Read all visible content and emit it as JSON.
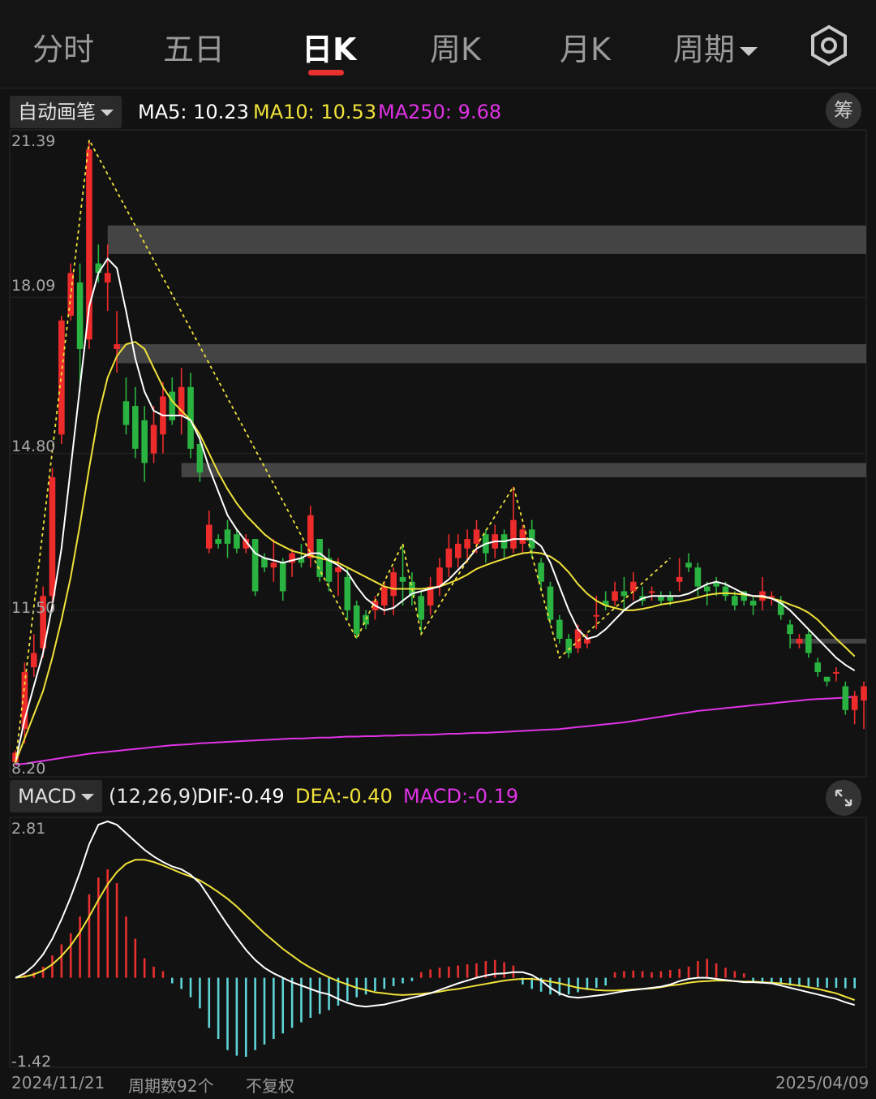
{
  "tabs": [
    {
      "label": "分时",
      "active": false
    },
    {
      "label": "五日",
      "active": false
    },
    {
      "label": "日K",
      "active": true
    },
    {
      "label": "周K",
      "active": false
    },
    {
      "label": "月K",
      "active": false
    },
    {
      "label": "周期",
      "active": false,
      "dropdown": true
    }
  ],
  "toolbar": {
    "settings_icon": "hexagon-gear-icon"
  },
  "main_panel": {
    "mode_label": "自动画笔",
    "ma5": {
      "label": "MA5:",
      "value": "10.23",
      "color": "#ffffff"
    },
    "ma10": {
      "label": "MA10:",
      "value": "10.53",
      "color": "#f0e23a"
    },
    "ma250": {
      "label": "MA250:",
      "value": "9.68",
      "color": "#e033e6"
    },
    "chip_button": "筹",
    "y_ticks": [
      "21.39",
      "18.09",
      "14.80",
      "11.50",
      "8.20"
    ]
  },
  "macd_panel": {
    "indicator_label": "MACD",
    "params": "(12,26,9)",
    "dif": {
      "label": "DIF:",
      "value": "-0.49",
      "color": "#ffffff"
    },
    "dea": {
      "label": "DEA:",
      "value": "-0.40",
      "color": "#f0e23a"
    },
    "macd": {
      "label": "MACD:",
      "value": "-0.19",
      "color": "#e033e6"
    },
    "expand_icon": "expand-arrows-icon",
    "y_ticks": [
      "2.81",
      "-1.42"
    ]
  },
  "footer": {
    "start_date": "2024/11/21",
    "period_count": "周期数92个",
    "adjust_mode": "不复权",
    "end_date": "2025/04/09"
  },
  "colors": {
    "up": "#ee2b2b",
    "down": "#2ab340",
    "ma250": "#e033e6",
    "hist_up": "#e8302f",
    "hist_down": "#5fd4d8"
  },
  "chart_data": [
    {
      "type": "candlestick",
      "y_axis_ticks": [
        21.39,
        18.09,
        14.8,
        11.5,
        8.2
      ],
      "ylim": [
        8.2,
        21.39
      ],
      "periods": 92,
      "candles": [
        [
          8.3,
          8.5,
          8.25,
          8.55
        ],
        [
          9.0,
          10.2,
          8.7,
          10.4
        ],
        [
          10.3,
          10.6,
          10.1,
          11.0
        ],
        [
          10.7,
          11.8,
          10.5,
          12.0
        ],
        [
          11.8,
          14.3,
          11.5,
          14.5
        ],
        [
          15.2,
          17.6,
          15.0,
          17.7
        ],
        [
          17.7,
          18.6,
          17.6,
          18.8
        ],
        [
          18.4,
          17.0,
          16.1,
          18.8
        ],
        [
          17.2,
          21.2,
          17.0,
          21.4
        ],
        [
          18.8,
          18.6,
          18.4,
          19.2
        ],
        [
          18.4,
          18.6,
          17.8,
          19.2
        ],
        [
          17.0,
          17.1,
          16.5,
          17.8
        ],
        [
          15.9,
          15.4,
          15.2,
          16.4
        ],
        [
          15.8,
          14.9,
          14.7,
          16.2
        ],
        [
          15.5,
          14.6,
          14.2,
          15.8
        ],
        [
          14.8,
          15.4,
          14.6,
          15.8
        ],
        [
          15.2,
          16.0,
          14.8,
          16.3
        ],
        [
          16.1,
          15.5,
          15.4,
          16.4
        ],
        [
          15.6,
          16.2,
          15.2,
          16.6
        ],
        [
          16.2,
          14.9,
          14.7,
          16.5
        ],
        [
          15.0,
          14.4,
          14.2,
          15.2
        ],
        [
          12.8,
          13.3,
          12.7,
          13.6
        ],
        [
          13.0,
          12.9,
          12.8,
          13.1
        ],
        [
          13.2,
          12.9,
          12.6,
          13.4
        ],
        [
          13.1,
          12.8,
          12.7,
          13.2
        ],
        [
          12.8,
          13.0,
          12.7,
          13.1
        ],
        [
          13.0,
          11.9,
          11.8,
          13.0
        ],
        [
          12.6,
          12.4,
          12.3,
          12.7
        ],
        [
          12.4,
          12.5,
          12.1,
          13.0
        ],
        [
          12.5,
          11.9,
          11.7,
          12.6
        ],
        [
          12.5,
          12.7,
          12.2,
          12.8
        ],
        [
          12.6,
          12.5,
          12.4,
          12.9
        ],
        [
          12.6,
          13.5,
          12.4,
          13.7
        ],
        [
          13.0,
          12.2,
          12.1,
          13.0
        ],
        [
          12.6,
          12.1,
          11.9,
          12.8
        ],
        [
          12.3,
          12.4,
          11.8,
          12.6
        ],
        [
          12.2,
          11.5,
          11.3,
          12.4
        ],
        [
          11.6,
          11.0,
          10.9,
          11.7
        ],
        [
          11.4,
          11.2,
          11.1,
          11.5
        ],
        [
          11.5,
          11.7,
          11.3,
          11.8
        ],
        [
          11.6,
          12.0,
          11.4,
          12.1
        ],
        [
          11.8,
          12.3,
          11.4,
          12.4
        ],
        [
          12.2,
          12.1,
          11.6,
          12.9
        ],
        [
          12.1,
          11.8,
          11.6,
          12.3
        ],
        [
          11.8,
          11.3,
          11.0,
          11.9
        ],
        [
          11.6,
          12.0,
          11.4,
          12.2
        ],
        [
          12.0,
          12.4,
          11.8,
          12.6
        ],
        [
          12.4,
          12.8,
          12.2,
          13.1
        ],
        [
          12.6,
          12.9,
          12.4,
          13.1
        ],
        [
          12.8,
          13.0,
          12.5,
          13.2
        ],
        [
          12.9,
          13.2,
          12.7,
          13.4
        ],
        [
          13.1,
          12.7,
          12.5,
          13.2
        ],
        [
          12.8,
          13.1,
          12.6,
          13.3
        ],
        [
          13.1,
          12.8,
          12.6,
          13.2
        ],
        [
          12.8,
          13.4,
          12.7,
          14.1
        ],
        [
          12.9,
          13.2,
          12.7,
          13.3
        ],
        [
          13.2,
          12.8,
          12.6,
          13.4
        ],
        [
          12.5,
          12.1,
          11.9,
          12.6
        ],
        [
          12.0,
          11.3,
          11.2,
          12.1
        ],
        [
          11.3,
          10.9,
          10.8,
          11.4
        ],
        [
          10.9,
          10.6,
          10.5,
          11.0
        ],
        [
          10.7,
          11.1,
          10.6,
          11.2
        ],
        [
          10.8,
          10.9,
          10.7,
          11.0
        ],
        [
          11.4,
          11.4,
          11.1,
          11.8
        ],
        [
          11.7,
          11.6,
          11.5,
          11.9
        ],
        [
          11.7,
          11.9,
          11.6,
          12.1
        ],
        [
          11.9,
          11.8,
          11.5,
          12.2
        ],
        [
          11.9,
          12.1,
          11.7,
          12.3
        ],
        [
          11.8,
          11.7,
          11.6,
          12.0
        ],
        [
          11.9,
          11.9,
          11.7,
          12.0
        ],
        [
          11.8,
          11.7,
          11.6,
          11.9
        ],
        [
          11.8,
          11.7,
          11.6,
          11.9
        ],
        [
          12.1,
          12.2,
          11.9,
          12.6
        ],
        [
          12.5,
          12.4,
          12.3,
          12.7
        ],
        [
          12.4,
          12.0,
          11.8,
          12.5
        ],
        [
          12.0,
          11.9,
          11.6,
          12.1
        ],
        [
          12.1,
          12.0,
          11.8,
          12.2
        ],
        [
          12.0,
          11.8,
          11.7,
          12.1
        ],
        [
          11.8,
          11.6,
          11.5,
          11.9
        ],
        [
          11.9,
          11.7,
          11.6,
          11.9
        ],
        [
          11.7,
          11.6,
          11.4,
          11.8
        ],
        [
          11.7,
          11.9,
          11.5,
          12.2
        ],
        [
          11.8,
          11.8,
          11.6,
          11.9
        ],
        [
          11.7,
          11.4,
          11.3,
          11.8
        ],
        [
          11.2,
          11.0,
          10.7,
          11.3
        ],
        [
          10.8,
          10.9,
          10.7,
          11.0
        ],
        [
          11.0,
          10.6,
          10.5,
          11.1
        ],
        [
          10.4,
          10.2,
          10.1,
          10.5
        ],
        [
          10.1,
          10.0,
          9.9,
          10.1
        ],
        [
          10.2,
          10.2,
          10.0,
          10.3
        ],
        [
          9.9,
          9.4,
          9.3,
          10.0
        ],
        [
          9.4,
          9.7,
          9.1,
          9.8
        ],
        [
          9.6,
          9.9,
          9.0,
          10.0
        ]
      ],
      "ma5": [
        8.3,
        9.2,
        9.9,
        10.6,
        11.6,
        12.8,
        14.5,
        16.2,
        17.9,
        18.6,
        18.9,
        18.7,
        17.8,
        16.8,
        16.1,
        15.7,
        15.6,
        15.6,
        15.6,
        15.5,
        15.1,
        14.5,
        14.0,
        13.5,
        13.2,
        12.95,
        12.7,
        12.6,
        12.55,
        12.5,
        12.55,
        12.6,
        12.7,
        12.7,
        12.55,
        12.45,
        12.3,
        12.0,
        11.75,
        11.6,
        11.5,
        11.55,
        11.7,
        11.85,
        11.9,
        11.95,
        12.0,
        12.15,
        12.35,
        12.55,
        12.8,
        12.9,
        12.95,
        12.95,
        13.0,
        13.0,
        13.0,
        12.85,
        12.5,
        12.0,
        11.5,
        11.1,
        10.9,
        10.95,
        11.1,
        11.3,
        11.5,
        11.65,
        11.75,
        11.8,
        11.8,
        11.8,
        11.8,
        11.85,
        11.95,
        12.05,
        12.1,
        12.05,
        11.95,
        11.85,
        11.8,
        11.8,
        11.75,
        11.65,
        11.5,
        11.3,
        11.1,
        10.9,
        10.7,
        10.5,
        10.35,
        10.23
      ],
      "ma10": [
        8.3,
        8.8,
        9.3,
        9.8,
        10.5,
        11.3,
        12.2,
        13.3,
        14.5,
        15.6,
        16.4,
        16.85,
        17.1,
        17.15,
        17.0,
        16.6,
        16.2,
        15.9,
        15.7,
        15.5,
        15.2,
        14.8,
        14.4,
        14.05,
        13.75,
        13.5,
        13.3,
        13.1,
        12.95,
        12.85,
        12.75,
        12.7,
        12.65,
        12.6,
        12.55,
        12.5,
        12.4,
        12.3,
        12.2,
        12.1,
        12.0,
        11.95,
        11.95,
        11.95,
        11.95,
        11.97,
        12.0,
        12.07,
        12.15,
        12.25,
        12.37,
        12.45,
        12.52,
        12.58,
        12.65,
        12.7,
        12.72,
        12.7,
        12.63,
        12.5,
        12.3,
        12.05,
        11.85,
        11.7,
        11.6,
        11.55,
        11.5,
        11.5,
        11.53,
        11.57,
        11.62,
        11.65,
        11.68,
        11.72,
        11.77,
        11.82,
        11.85,
        11.86,
        11.85,
        11.83,
        11.8,
        11.78,
        11.75,
        11.7,
        11.62,
        11.55,
        11.45,
        11.3,
        11.1,
        10.9,
        10.72,
        10.53
      ],
      "ma250": [
        8.25,
        8.27,
        8.3,
        8.33,
        8.36,
        8.39,
        8.42,
        8.45,
        8.48,
        8.5,
        8.52,
        8.54,
        8.56,
        8.58,
        8.6,
        8.62,
        8.64,
        8.66,
        8.67,
        8.68,
        8.7,
        8.71,
        8.72,
        8.73,
        8.74,
        8.75,
        8.76,
        8.77,
        8.78,
        8.79,
        8.8,
        8.8,
        8.81,
        8.82,
        8.82,
        8.83,
        8.84,
        8.84,
        8.85,
        8.85,
        8.86,
        8.86,
        8.87,
        8.87,
        8.88,
        8.88,
        8.89,
        8.9,
        8.9,
        8.91,
        8.92,
        8.92,
        8.93,
        8.94,
        8.95,
        8.96,
        8.97,
        8.98,
        8.99,
        9.0,
        9.02,
        9.04,
        9.06,
        9.08,
        9.1,
        9.12,
        9.14,
        9.17,
        9.2,
        9.23,
        9.26,
        9.29,
        9.32,
        9.35,
        9.38,
        9.4,
        9.42,
        9.44,
        9.46,
        9.48,
        9.5,
        9.52,
        9.54,
        9.56,
        9.58,
        9.6,
        9.62,
        9.63,
        9.64,
        9.65,
        9.66,
        9.68
      ],
      "bi_pivots": [
        [
          0,
          8.3
        ],
        [
          8,
          21.4
        ],
        [
          37,
          10.9
        ],
        [
          42,
          12.9
        ],
        [
          44,
          11.0
        ],
        [
          54,
          14.1
        ],
        [
          59,
          10.5
        ],
        [
          71,
          12.6
        ]
      ],
      "resistance_bands": [
        [
          10,
          19.0,
          19.6
        ],
        [
          11,
          16.7,
          17.1
        ],
        [
          18,
          14.3,
          14.6
        ],
        [
          84,
          10.8,
          10.9
        ]
      ]
    },
    {
      "type": "macd",
      "params": [
        12,
        26,
        9
      ],
      "y_axis_ticks": [
        2.81,
        -1.42
      ],
      "ylim": [
        -1.42,
        2.81
      ],
      "dif": [
        0.0,
        0.08,
        0.22,
        0.42,
        0.7,
        1.05,
        1.45,
        1.9,
        2.4,
        2.75,
        2.81,
        2.75,
        2.6,
        2.45,
        2.3,
        2.18,
        2.08,
        2.0,
        1.95,
        1.85,
        1.7,
        1.45,
        1.2,
        0.95,
        0.72,
        0.5,
        0.32,
        0.18,
        0.08,
        0.0,
        -0.08,
        -0.14,
        -0.2,
        -0.26,
        -0.3,
        -0.38,
        -0.45,
        -0.5,
        -0.52,
        -0.5,
        -0.48,
        -0.44,
        -0.4,
        -0.36,
        -0.32,
        -0.28,
        -0.22,
        -0.16,
        -0.1,
        -0.05,
        0.0,
        0.04,
        0.07,
        0.08,
        0.1,
        0.1,
        0.05,
        -0.05,
        -0.18,
        -0.28,
        -0.34,
        -0.36,
        -0.34,
        -0.32,
        -0.3,
        -0.27,
        -0.24,
        -0.22,
        -0.2,
        -0.18,
        -0.16,
        -0.12,
        -0.06,
        -0.02,
        0.0,
        0.0,
        -0.02,
        -0.04,
        -0.06,
        -0.08,
        -0.08,
        -0.09,
        -0.1,
        -0.14,
        -0.18,
        -0.22,
        -0.26,
        -0.3,
        -0.34,
        -0.38,
        -0.44,
        -0.49
      ],
      "dea": [
        0.0,
        0.02,
        0.06,
        0.13,
        0.24,
        0.39,
        0.58,
        0.82,
        1.1,
        1.4,
        1.68,
        1.9,
        2.05,
        2.12,
        2.12,
        2.08,
        2.02,
        1.95,
        1.88,
        1.82,
        1.75,
        1.65,
        1.54,
        1.42,
        1.28,
        1.12,
        0.96,
        0.8,
        0.66,
        0.52,
        0.4,
        0.28,
        0.18,
        0.09,
        0.01,
        -0.06,
        -0.12,
        -0.18,
        -0.22,
        -0.26,
        -0.28,
        -0.3,
        -0.31,
        -0.3,
        -0.29,
        -0.27,
        -0.25,
        -0.22,
        -0.2,
        -0.17,
        -0.14,
        -0.11,
        -0.08,
        -0.05,
        -0.03,
        -0.02,
        -0.02,
        -0.04,
        -0.07,
        -0.1,
        -0.14,
        -0.18,
        -0.2,
        -0.22,
        -0.23,
        -0.23,
        -0.22,
        -0.21,
        -0.2,
        -0.19,
        -0.17,
        -0.14,
        -0.12,
        -0.09,
        -0.07,
        -0.06,
        -0.05,
        -0.05,
        -0.06,
        -0.07,
        -0.07,
        -0.08,
        -0.09,
        -0.1,
        -0.12,
        -0.14,
        -0.17,
        -0.2,
        -0.24,
        -0.28,
        -0.34,
        -0.4
      ],
      "hist": [
        0.0,
        0.05,
        0.1,
        0.2,
        0.4,
        0.6,
        0.8,
        1.1,
        1.5,
        1.8,
        1.95,
        1.7,
        1.1,
        0.7,
        0.35,
        0.2,
        0.12,
        -0.1,
        -0.2,
        -0.35,
        -0.55,
        -0.9,
        -1.1,
        -1.3,
        -1.4,
        -1.42,
        -1.3,
        -1.2,
        -1.1,
        -1.0,
        -0.9,
        -0.8,
        -0.72,
        -0.65,
        -0.58,
        -0.5,
        -0.42,
        -0.35,
        -0.3,
        -0.24,
        -0.2,
        -0.15,
        -0.1,
        -0.06,
        0.1,
        0.15,
        0.18,
        0.2,
        0.22,
        0.24,
        0.26,
        0.3,
        0.32,
        0.28,
        0.22,
        -0.12,
        -0.2,
        -0.25,
        -0.3,
        -0.32,
        -0.3,
        -0.26,
        -0.22,
        -0.18,
        -0.14,
        0.1,
        0.12,
        0.13,
        0.12,
        0.1,
        0.12,
        0.14,
        0.16,
        0.2,
        0.3,
        0.34,
        0.26,
        0.18,
        0.12,
        0.08,
        -0.06,
        -0.08,
        -0.1,
        -0.12,
        -0.14,
        -0.16,
        -0.16,
        -0.17,
        -0.18,
        -0.18,
        -0.19,
        -0.19
      ]
    }
  ]
}
